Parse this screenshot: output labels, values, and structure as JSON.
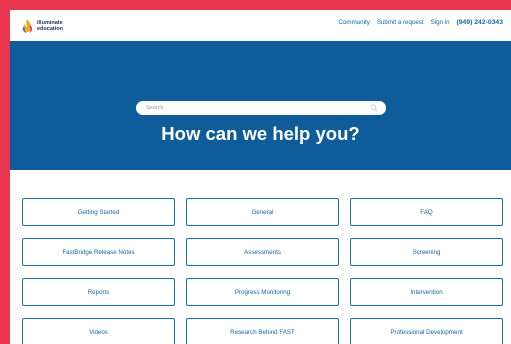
{
  "brand": {
    "logo_line1": "illuminate",
    "logo_line2": "education",
    "colors": {
      "accent": "#0e5d9a",
      "link": "#0e6aa6",
      "frame": "#e8364f"
    }
  },
  "nav": {
    "community": "Community",
    "submit_request": "Submit a request",
    "sign_in": "Sign in",
    "phone": "(949) 242-0343"
  },
  "hero": {
    "search_placeholder": "Search",
    "headline": "How can we help you?"
  },
  "categories": [
    "Getting Started",
    "General",
    "FAQ",
    "FastBridge Release Notes",
    "Assessments",
    "Screening",
    "Reports",
    "Progress Monitoring",
    "Intervention",
    "Videos",
    "Research Behind FAST",
    "Professional Development"
  ]
}
